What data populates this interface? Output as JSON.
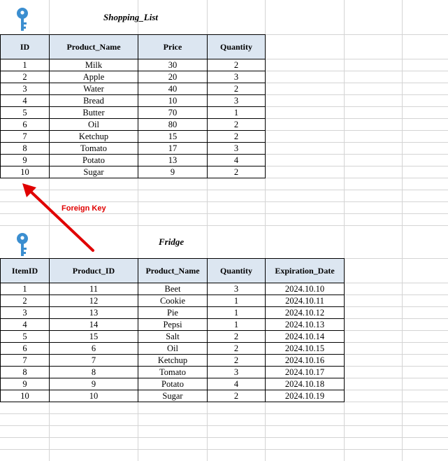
{
  "shopping_list": {
    "title": "Shopping_List",
    "headers": [
      "ID",
      "Product_Name",
      "Price",
      "Quantity"
    ],
    "rows": [
      [
        "1",
        "Milk",
        "30",
        "2"
      ],
      [
        "2",
        "Apple",
        "20",
        "3"
      ],
      [
        "3",
        "Water",
        "40",
        "2"
      ],
      [
        "4",
        "Bread",
        "10",
        "3"
      ],
      [
        "5",
        "Butter",
        "70",
        "1"
      ],
      [
        "6",
        "Oil",
        "80",
        "2"
      ],
      [
        "7",
        "Ketchup",
        "15",
        "2"
      ],
      [
        "8",
        "Tomato",
        "17",
        "3"
      ],
      [
        "9",
        "Potato",
        "13",
        "4"
      ],
      [
        "10",
        "Sugar",
        "9",
        "2"
      ]
    ]
  },
  "fridge": {
    "title": "Fridge",
    "headers": [
      "ItemID",
      "Product_ID",
      "Product_Name",
      "Quantity",
      "Expiration_Date"
    ],
    "rows": [
      [
        "1",
        "11",
        "Beet",
        "3",
        "2024.10.10"
      ],
      [
        "2",
        "12",
        "Cookie",
        "1",
        "2024.10.11"
      ],
      [
        "3",
        "13",
        "Pie",
        "1",
        "2024.10.12"
      ],
      [
        "4",
        "14",
        "Pepsi",
        "1",
        "2024.10.13"
      ],
      [
        "5",
        "15",
        "Salt",
        "2",
        "2024.10.14"
      ],
      [
        "6",
        "6",
        "Oil",
        "2",
        "2024.10.15"
      ],
      [
        "7",
        "7",
        "Ketchup",
        "2",
        "2024.10.16"
      ],
      [
        "8",
        "8",
        "Tomato",
        "3",
        "2024.10.17"
      ],
      [
        "9",
        "9",
        "Potato",
        "4",
        "2024.10.18"
      ],
      [
        "10",
        "10",
        "Sugar",
        "2",
        "2024.10.19"
      ]
    ]
  },
  "annotation": {
    "foreign_key_label": "Foreign Key",
    "arrow_color": "#e00000"
  },
  "icons": {
    "key_icon": "key-icon",
    "key_color": "#3b8ed0"
  },
  "colors": {
    "header_fill": "#dce6f1",
    "grid_line": "#d4d4d4"
  }
}
